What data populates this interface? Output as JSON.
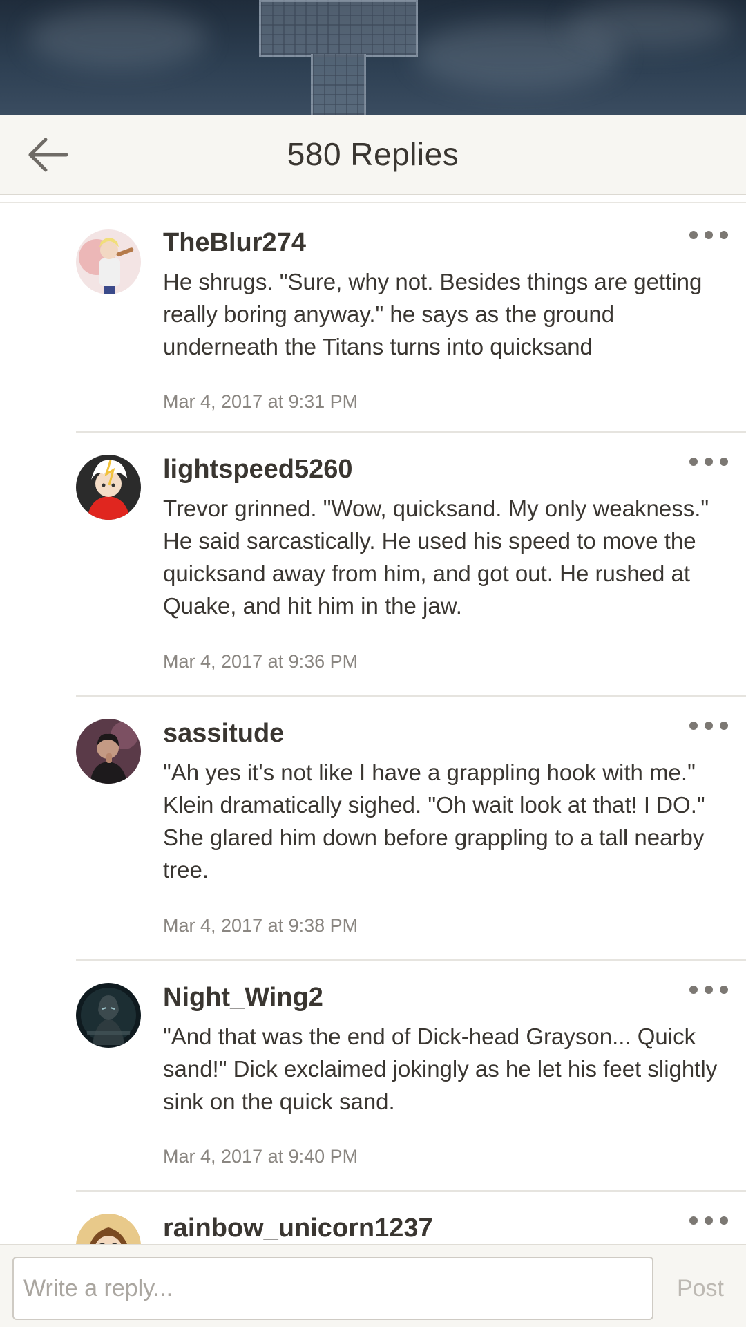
{
  "header": {
    "title": "580 Replies",
    "back_icon": "arrow-left-icon"
  },
  "replies": [
    {
      "username": "TheBlur274",
      "text": "He shrugs. \"Sure, why not. Besides things are getting really boring anyway.\" he says as the ground underneath the Titans turns into quicksand",
      "timestamp": "Mar 4, 2017 at 9:31 PM"
    },
    {
      "username": "lightspeed5260",
      "text": "Trevor grinned. \"Wow, quicksand. My only weakness.\" He said sarcastically. He used his speed to move the quicksand away from him, and got out. He rushed at Quake, and hit him in the jaw.",
      "timestamp": "Mar 4, 2017 at 9:36 PM"
    },
    {
      "username": "sassitude",
      "text": "\"Ah yes it's not like I have a grappling hook with me.\" Klein dramatically sighed. \"Oh wait look at that! I DO.\" She glared him down before grappling to a tall nearby tree.",
      "timestamp": "Mar 4, 2017 at 9:38 PM"
    },
    {
      "username": "Night_Wing2",
      "text": "\"And that was the end of Dick-head Grayson... Quick sand!\" Dick exclaimed jokingly as he let his feet slightly sink on the quick sand.",
      "timestamp": "Mar 4, 2017 at 9:40 PM"
    },
    {
      "username": "rainbow_unicorn1237",
      "text": "",
      "timestamp": ""
    }
  ],
  "composer": {
    "placeholder": "Write a reply...",
    "post_label": "Post"
  },
  "colors": {
    "topbar_bg": "#f7f6f2",
    "text": "#3a3631",
    "muted": "#8a8681",
    "post_disabled": "#bdb9b3"
  }
}
